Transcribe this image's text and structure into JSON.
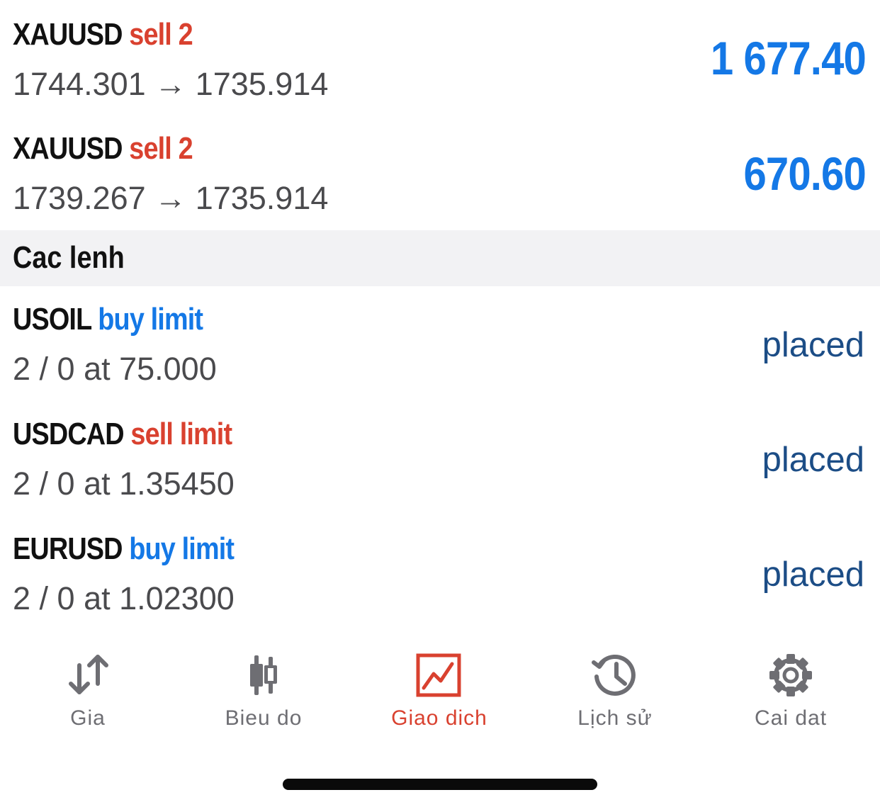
{
  "positions": [
    {
      "symbol": "XAUUSD",
      "side": "sell 2",
      "prices": "1744.301 → 1735.914",
      "profit": "1 677.40"
    },
    {
      "symbol": "XAUUSD",
      "side": "sell 2",
      "prices": "1739.267 → 1735.914",
      "profit": "670.60"
    }
  ],
  "orders_section": {
    "title": "Cac lenh"
  },
  "orders": [
    {
      "symbol": "USOIL",
      "type": "buy limit",
      "details": "2 / 0 at 75.000",
      "status": "placed"
    },
    {
      "symbol": "USDCAD",
      "type": "sell limit",
      "details": "2 / 0 at 1.35450",
      "status": "placed"
    },
    {
      "symbol": "EURUSD",
      "type": "buy limit",
      "details": "2 / 0 at 1.02300",
      "status": "placed"
    }
  ],
  "tabbar": {
    "tabs": [
      {
        "label": "Gia",
        "icon": "arrows-up-down-icon"
      },
      {
        "label": "Bieu do",
        "icon": "candlestick-icon"
      },
      {
        "label": "Giao dich",
        "icon": "trade-chart-icon",
        "active": true
      },
      {
        "label": "Lịch sử",
        "icon": "history-icon"
      },
      {
        "label": "Cai dat",
        "icon": "gear-icon"
      }
    ]
  },
  "colors": {
    "sell": "#d9412f",
    "buy": "#1478e6",
    "profit": "#1478e6",
    "status": "#1c4d86",
    "active_tab": "#d9412f",
    "inactive_tab": "#6e6e73"
  }
}
